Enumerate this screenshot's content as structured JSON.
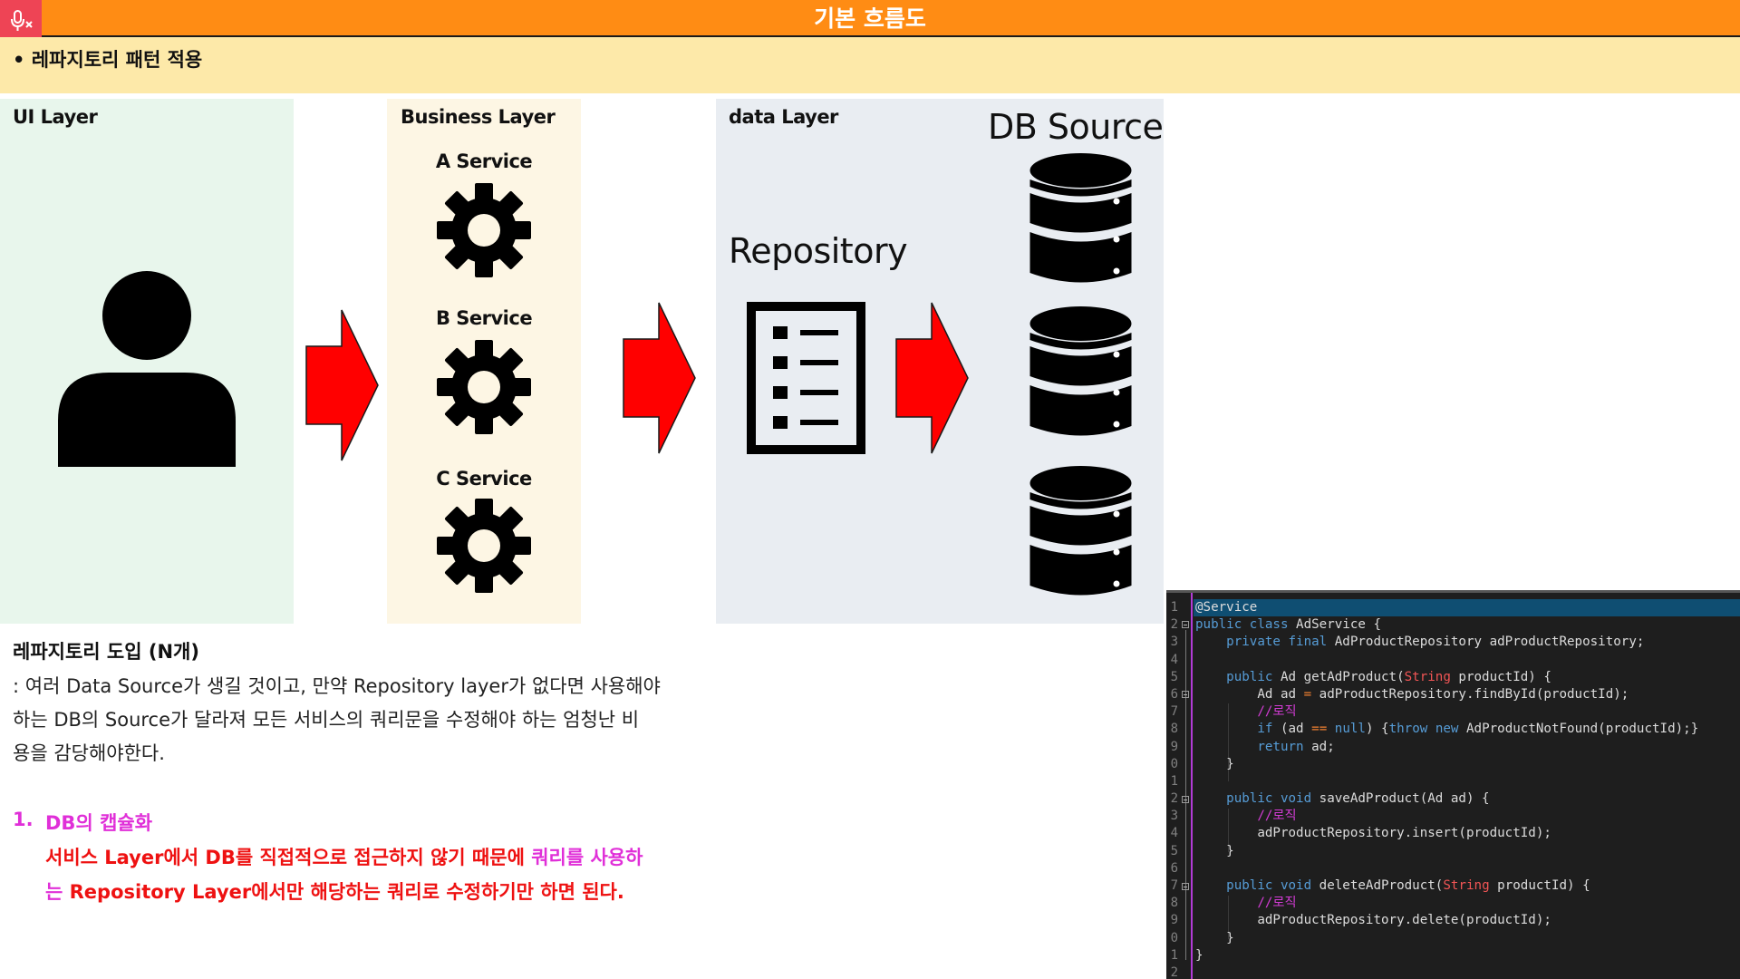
{
  "header": {
    "title": "기본 흐름도",
    "subtitle": "•  레파지토리 패턴 적용"
  },
  "icons": {
    "mic": "mic-off-icon",
    "user": "user-icon",
    "gear": "gear-icon",
    "arrow": "arrow-right-icon",
    "repository": "list-document-icon",
    "database": "database-icon"
  },
  "colors": {
    "title_bar": "#ff8c14",
    "subtitle_bar": "#fde9a9",
    "ui_panel": "#e8f6ec",
    "business_panel": "#fdf6e4",
    "data_panel": "#e9edf2",
    "arrow": "#ff0000",
    "emphasis_magenta": "#e02fd8",
    "emphasis_red": "#ee1111"
  },
  "diagram": {
    "ui_layer": {
      "label": "UI Layer"
    },
    "business_layer": {
      "label": "Business Layer",
      "services": [
        "A Service",
        "B Service",
        "C Service"
      ]
    },
    "data_layer": {
      "label": "data Layer",
      "repository_label": "Repository",
      "db_source_label": "DB Source"
    }
  },
  "description": {
    "title": "레파지토리 도입 (N개)",
    "lines": [
      ": 여러 Data Source가 생길 것이고, 만약 Repository layer가 없다면 사용해야",
      "하는 DB의 Source가 달라져 모든 서비스의 쿼리문을 수정해야 하는 엄청난 비",
      "용을 감당해야한다."
    ],
    "point": {
      "number": "1.",
      "title": "DB의 캡슐화",
      "line1_red": "서비스 Layer에서 DB를 직접적으로 접근하지 않기 때문에 ",
      "line1_magenta": "쿼리를 사용하",
      "line2_magenta": "는 ",
      "line2_red": "Repository Layer에서만 해당하는 쿼리로 수정하기만 하면 된다."
    }
  },
  "code": {
    "line_numbers": [
      "1",
      "2",
      "3",
      "4",
      "5",
      "6",
      "7",
      "8",
      "9",
      "0",
      "1",
      "2",
      "3",
      "4",
      "5",
      "6",
      "7",
      "8",
      "9",
      "0",
      "1",
      "2"
    ],
    "annotation": "@Service",
    "class_decl": {
      "kw": "public class",
      "name": " AdService {"
    },
    "field": {
      "kw": "private final",
      "rest": " AdProductRepository adProductRepository;"
    },
    "get_method": {
      "kw": "public",
      "rest1": " Ad getAdProduct(",
      "type": "String",
      "rest2": " productId) {"
    },
    "get_body1": {
      "a": "Ad ad ",
      "op": "=",
      "b": " adProductRepository.findById(productId);"
    },
    "comment": "//로직",
    "if_line": {
      "kw": "if",
      "a": " (ad ",
      "op": "==",
      "b": " ",
      "kw2": "null",
      "c": ") {",
      "kw3": "throw new",
      "d": " AdProductNotFound(productId);}"
    },
    "return_line": {
      "kw": "return",
      "rest": " ad;"
    },
    "close_brace": "}",
    "save_method": {
      "kw": "public void",
      "rest": " saveAdProduct(Ad ad) {"
    },
    "save_body": "adProductRepository.insert(productId);",
    "delete_method": {
      "kw": "public void",
      "rest1": " deleteAdProduct(",
      "type": "String",
      "rest2": " productId) {"
    },
    "delete_body": "adProductRepository.delete(productId);"
  }
}
